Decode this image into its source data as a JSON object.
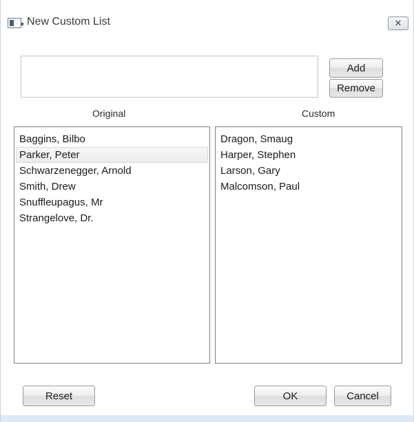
{
  "window": {
    "title": "New Custom List",
    "close_symbol": "✕",
    "icon": "window-app-icon"
  },
  "input": {
    "value": "",
    "placeholder": ""
  },
  "buttons": {
    "add": "Add",
    "remove": "Remove",
    "reset": "Reset",
    "ok": "OK",
    "cancel": "Cancel"
  },
  "lists": {
    "original": {
      "label": "Original",
      "selected_index": 1,
      "items": [
        "Baggins, Bilbo",
        "Parker, Peter",
        "Schwarzenegger, Arnold",
        "Smith, Drew",
        "Snuffleupagus, Mr",
        "Strangelove, Dr."
      ]
    },
    "custom": {
      "label": "Custom",
      "items": [
        "Dragon, Smaug",
        "Harper, Stephen",
        "Larson, Gary",
        "Malcomson, Paul"
      ]
    }
  }
}
